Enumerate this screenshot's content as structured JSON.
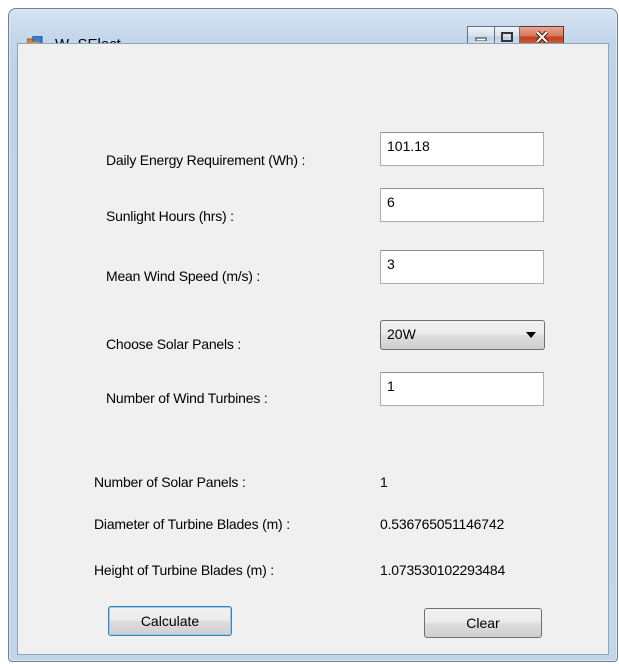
{
  "window": {
    "title": "W_SElect",
    "icons": {
      "app": "app-window-icon",
      "minimize": "minimize-icon",
      "maximize": "maximize-icon",
      "close": "close-icon"
    }
  },
  "form": {
    "daily_energy": {
      "label": "Daily Energy Requirement (Wh) :",
      "value": "101.18"
    },
    "sunlight": {
      "label": "Sunlight Hours (hrs) :",
      "value": "6"
    },
    "wind_speed": {
      "label": "Mean Wind Speed (m/s) :",
      "value": "3"
    },
    "solar_panels": {
      "label": "Choose Solar Panels :",
      "selected": "20W"
    },
    "turbines": {
      "label": "Number of Wind Turbines :",
      "value": "1"
    }
  },
  "results": {
    "num_panels": {
      "label": "Number of Solar Panels :",
      "value": "1"
    },
    "diameter": {
      "label": "Diameter of Turbine Blades (m) :",
      "value": "0.536765051146742"
    },
    "height": {
      "label": "Height of Turbine Blades (m) :",
      "value": "1.07353010229348​4"
    }
  },
  "buttons": {
    "calculate": "Calculate",
    "clear": "Clear"
  }
}
